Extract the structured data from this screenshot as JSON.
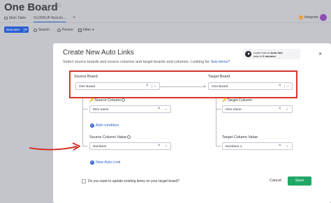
{
  "board": {
    "title": "One Board",
    "integrate_label": "Integrate"
  },
  "tabs": [
    {
      "label": "Main Table"
    },
    {
      "label": "VLOOKUP Auto-lin..."
    }
  ],
  "toolbar": {
    "new_item": "New Item",
    "search": "Search",
    "person": "Person",
    "filter": "Filter"
  },
  "modal": {
    "title": "Create New Auto Links",
    "subtitle_prefix": "Select source boards and source columns and target boards and columns. Looking for ",
    "subtitle_link": "Sub-items",
    "subtitle_suffix": "?",
    "learn_line1_prefix": "Learn how to ",
    "learn_line1_bold": "Auto-link",
    "learn_line2_prefix": "data in ",
    "learn_line2_bold": "3 minutes",
    "source_board_label": "Source Board",
    "target_board_label": "Target Board",
    "source_board_value": "One Board",
    "target_board_value": "One Board",
    "source_column_label": "Source Column",
    "target_column_label": "Target Column",
    "source_column_value": "Item name",
    "target_column_value": "Item name",
    "add_condition": "Add condition",
    "source_column_value_label": "Source Column Value",
    "target_column_value_label": "Target Column Value",
    "source_column_value_value": "Numbers",
    "target_column_value_value": "Numbers 1",
    "new_auto_link": "New Auto-Link",
    "update_existing_label": "Do you want to update existing items on your target board?",
    "cancel": "Cancel",
    "save": "Save"
  },
  "colors": {
    "accent": "#2b63c9",
    "save": "#1fa866",
    "highlight": "#d4352a"
  }
}
